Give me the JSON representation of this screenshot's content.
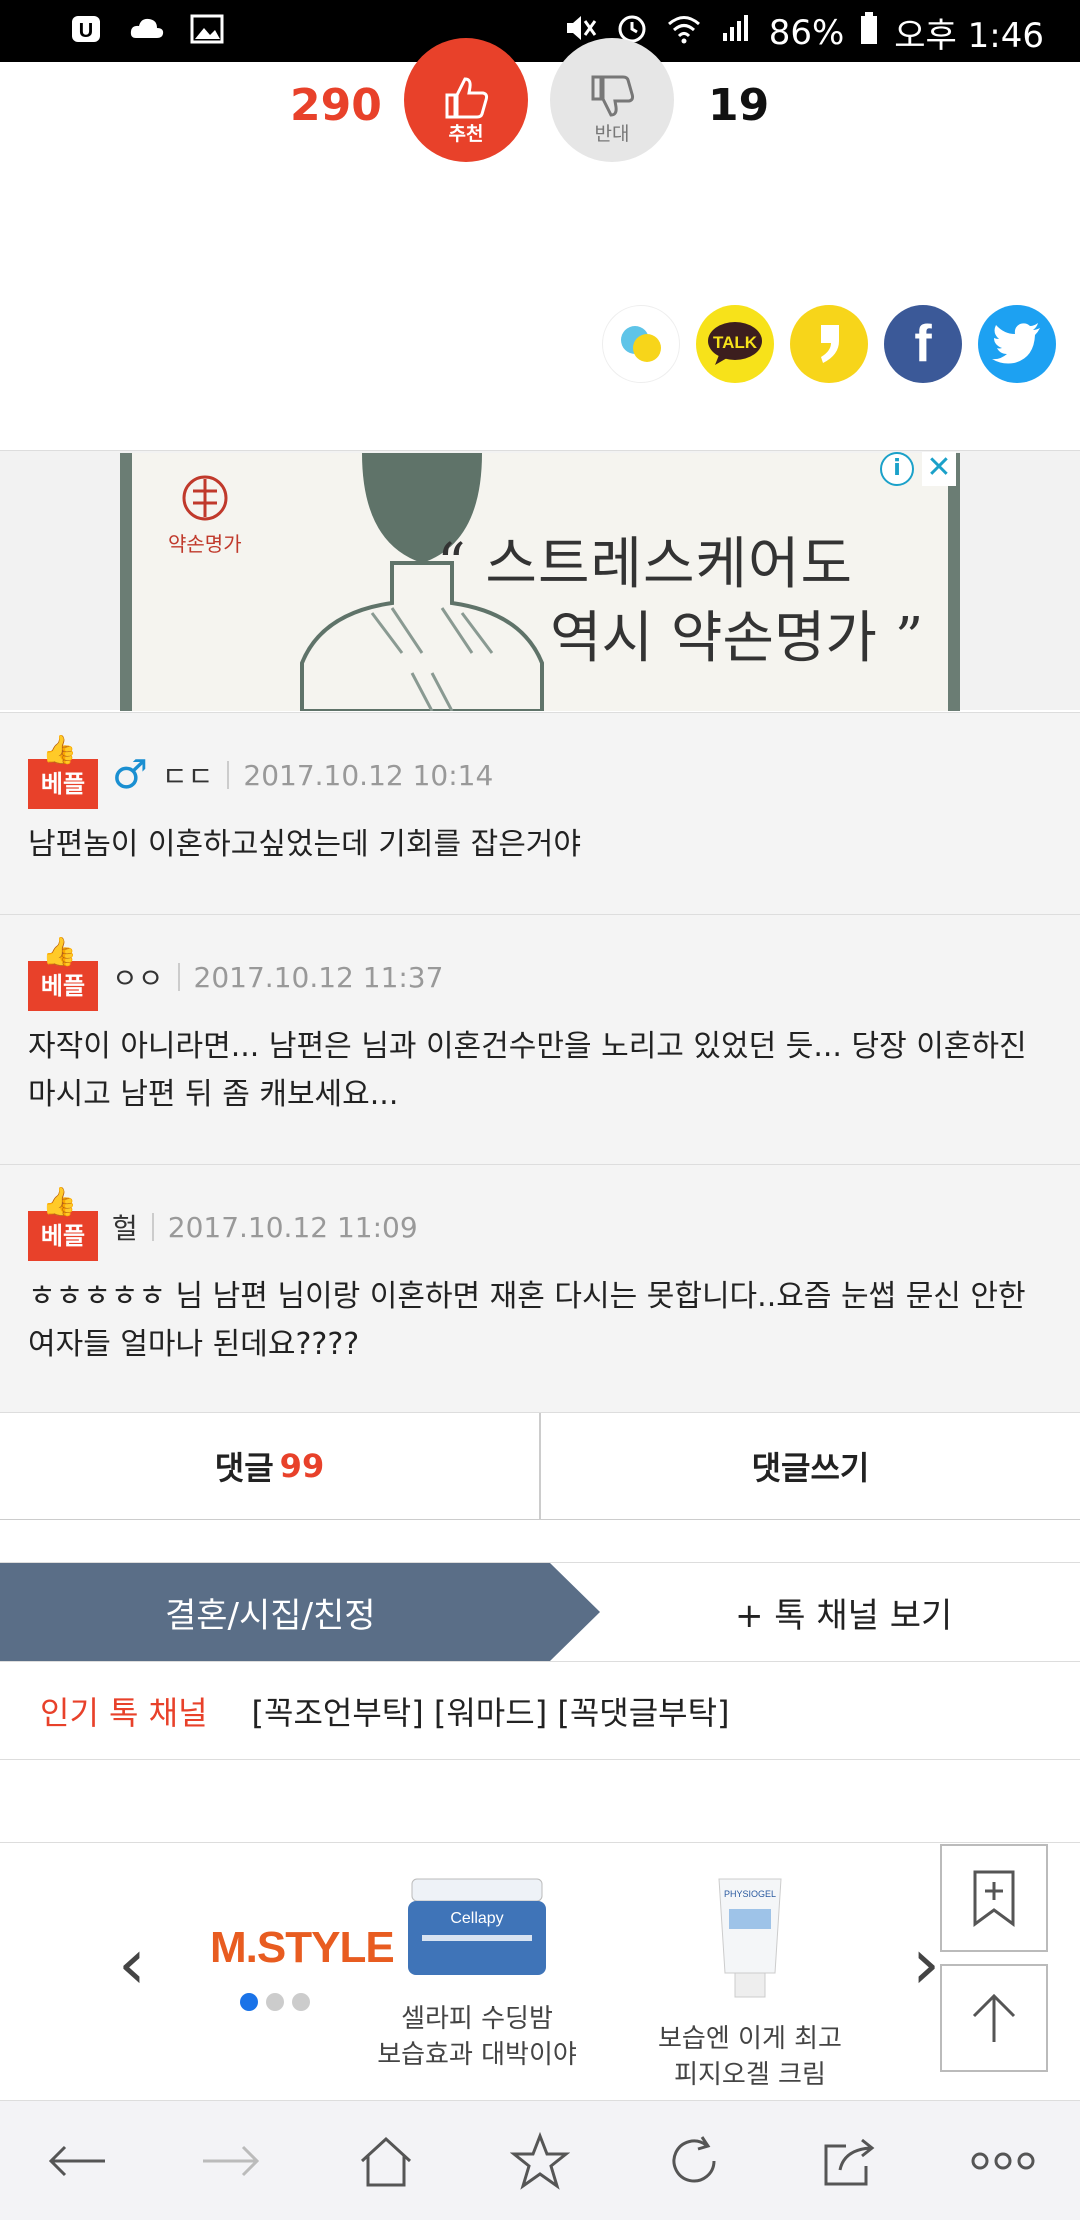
{
  "status_bar": {
    "battery": "86%",
    "time": "오후 1:46"
  },
  "vote": {
    "up_count": "290",
    "up_label": "추천",
    "down_label": "반대",
    "down_count": "19"
  },
  "share": {
    "talk_label": "TALK",
    "facebook_label": "f"
  },
  "ad": {
    "brand": "약손명가",
    "line1": "“ 스트레스케어도",
    "line2": "역시 약손명가 ”",
    "info": "i",
    "close": "✕"
  },
  "comments": [
    {
      "badge": "베플",
      "gender": "♂",
      "nick": "ㄷㄷ",
      "date": "2017.10.12 10:14",
      "body": "남편놈이 이혼하고싶었는데 기회를 잡은거야"
    },
    {
      "badge": "베플",
      "nick": "ㅇㅇ",
      "date": "2017.10.12 11:37",
      "body": "자작이 아니라면... 남편은 님과 이혼건수만을 노리고 있었던 듯... 당장 이혼하진 마시고 남편 뒤 좀 캐보세요..."
    },
    {
      "badge": "베플",
      "nick": "헐",
      "date": "2017.10.12 11:09",
      "body": "ㅎㅎㅎㅎㅎ 님 남편 님이랑 이혼하면 재혼 다시는 못합니다..요즘 눈썹 문신 안한 여자들 얼마나 된데요????"
    }
  ],
  "comment_bar": {
    "comments_label": "댓글",
    "comments_count": "99",
    "write_label": "댓글쓰기"
  },
  "channel": {
    "current": "결혼/시집/친정",
    "more": "+ 톡 채널 보기"
  },
  "popular": {
    "label": "인기 톡 채널",
    "tags": "[꼭조언부탁] [워마드] [꼭댓글부탁]"
  },
  "shop": {
    "logo": "M.STYLE",
    "products": [
      {
        "brand": "Cellapy",
        "line1": "셀라피 수딩밤",
        "line2": "보습효과 대박이야"
      },
      {
        "brand": "PHYSIOGEL",
        "line1": "보습엔 이게 최고",
        "line2": "피지오겔 크림"
      }
    ]
  },
  "colors": {
    "accent": "#e8412a",
    "channel_tab": "#5a6e87"
  }
}
